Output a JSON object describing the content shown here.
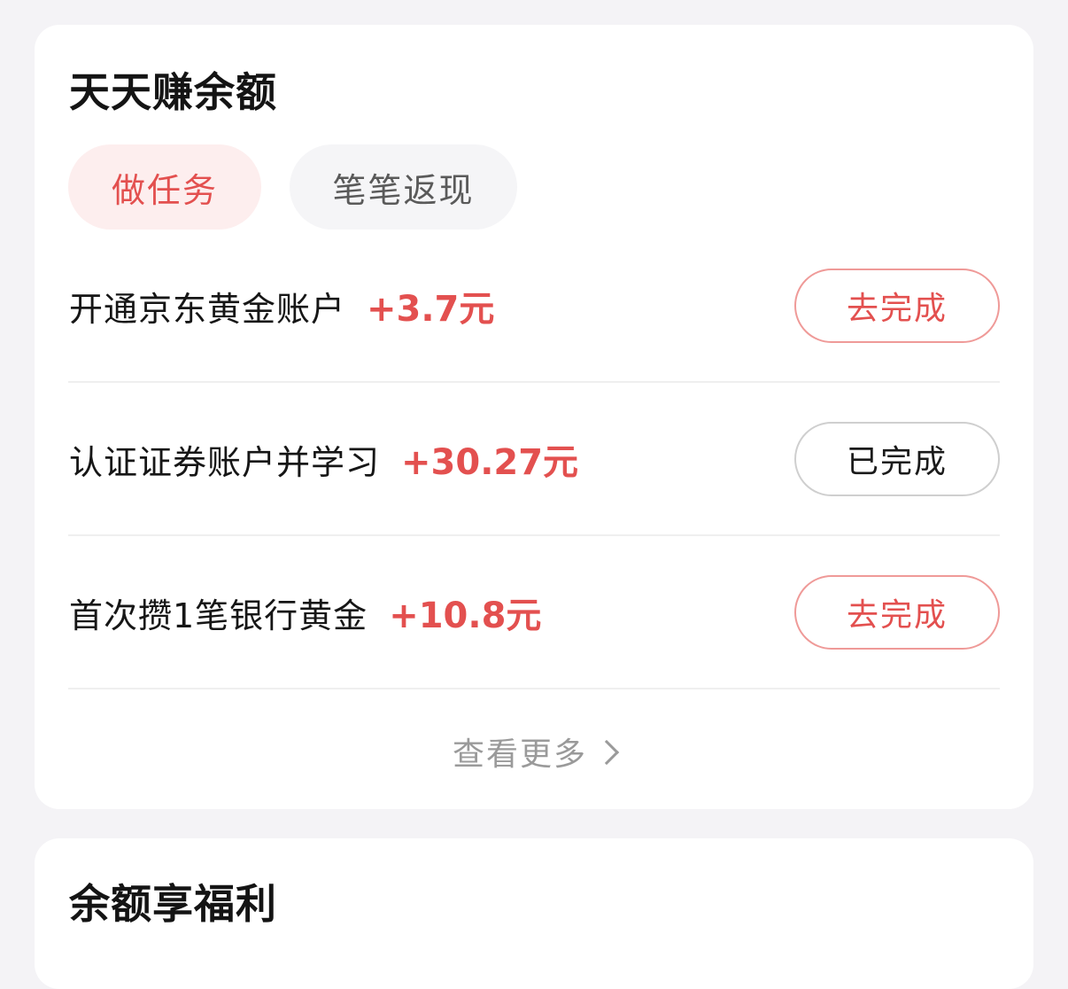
{
  "earn_card": {
    "title": "天天赚余额",
    "tabs": [
      {
        "label": "做任务",
        "active": true
      },
      {
        "label": "笔笔返现",
        "active": false
      }
    ],
    "tasks": [
      {
        "name": "开通京东黄金账户",
        "reward": "+3.7元",
        "action": "去完成",
        "status": "todo"
      },
      {
        "name": "认证证券账户并学习",
        "reward": "+30.27元",
        "action": "已完成",
        "status": "done"
      },
      {
        "name": "首次攒1笔银行黄金",
        "reward": "+10.8元",
        "action": "去完成",
        "status": "todo"
      }
    ],
    "view_more": "查看更多"
  },
  "benefits_card": {
    "title": "余额享福利"
  },
  "colors": {
    "accent": "#e3504f",
    "accent_border": "#ef9a98",
    "tab_active_bg": "#fdeeee",
    "tab_inactive_bg": "#f5f5f7",
    "page_bg": "#f4f3f6",
    "muted_text": "#9a9a9a"
  }
}
